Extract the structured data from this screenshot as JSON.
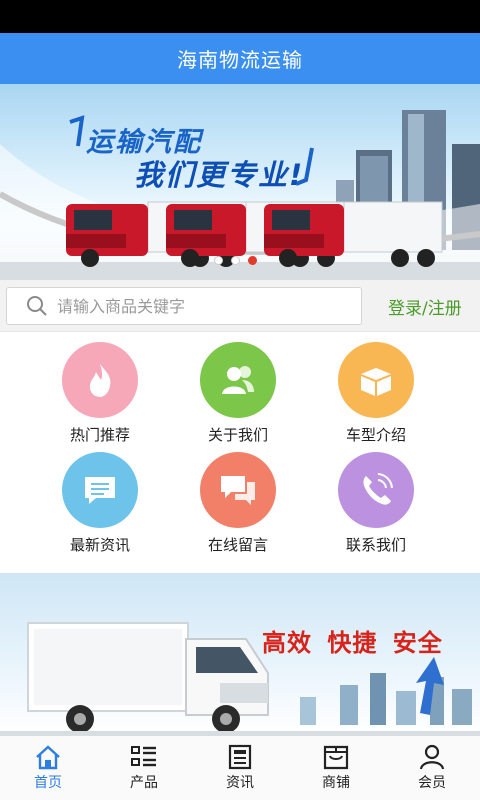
{
  "header": {
    "title": "海南物流运输"
  },
  "hero_banner": {
    "slogan_line1": "运输汽配",
    "slogan_line2": "我们更专业!",
    "slide_count": 3,
    "active_slide": 3
  },
  "search": {
    "placeholder": "请输入商品关键字",
    "login_label": "登录/注册"
  },
  "menu": [
    {
      "label": "热门推荐",
      "icon": "flame-icon",
      "color": "#f6a8b8"
    },
    {
      "label": "关于我们",
      "icon": "users-icon",
      "color": "#7cc64a"
    },
    {
      "label": "车型介绍",
      "icon": "box-icon",
      "color": "#f9b754"
    },
    {
      "label": "最新资讯",
      "icon": "message-icon",
      "color": "#6ec3ea"
    },
    {
      "label": "在线留言",
      "icon": "chat-icon",
      "color": "#f28069"
    },
    {
      "label": "联系我们",
      "icon": "phone-icon",
      "color": "#bc92e0"
    }
  ],
  "promo_banner": {
    "slogan": "高效 快捷 安全"
  },
  "tabs": [
    {
      "label": "首页",
      "icon": "home-icon",
      "active": true
    },
    {
      "label": "产品",
      "icon": "list-icon",
      "active": false
    },
    {
      "label": "资讯",
      "icon": "news-icon",
      "active": false
    },
    {
      "label": "商铺",
      "icon": "shop-icon",
      "active": false
    },
    {
      "label": "会员",
      "icon": "user-icon",
      "active": false
    }
  ],
  "colors": {
    "header": "#3a8ff0",
    "tab_active": "#2e7de0",
    "login": "#4c9a2a"
  }
}
